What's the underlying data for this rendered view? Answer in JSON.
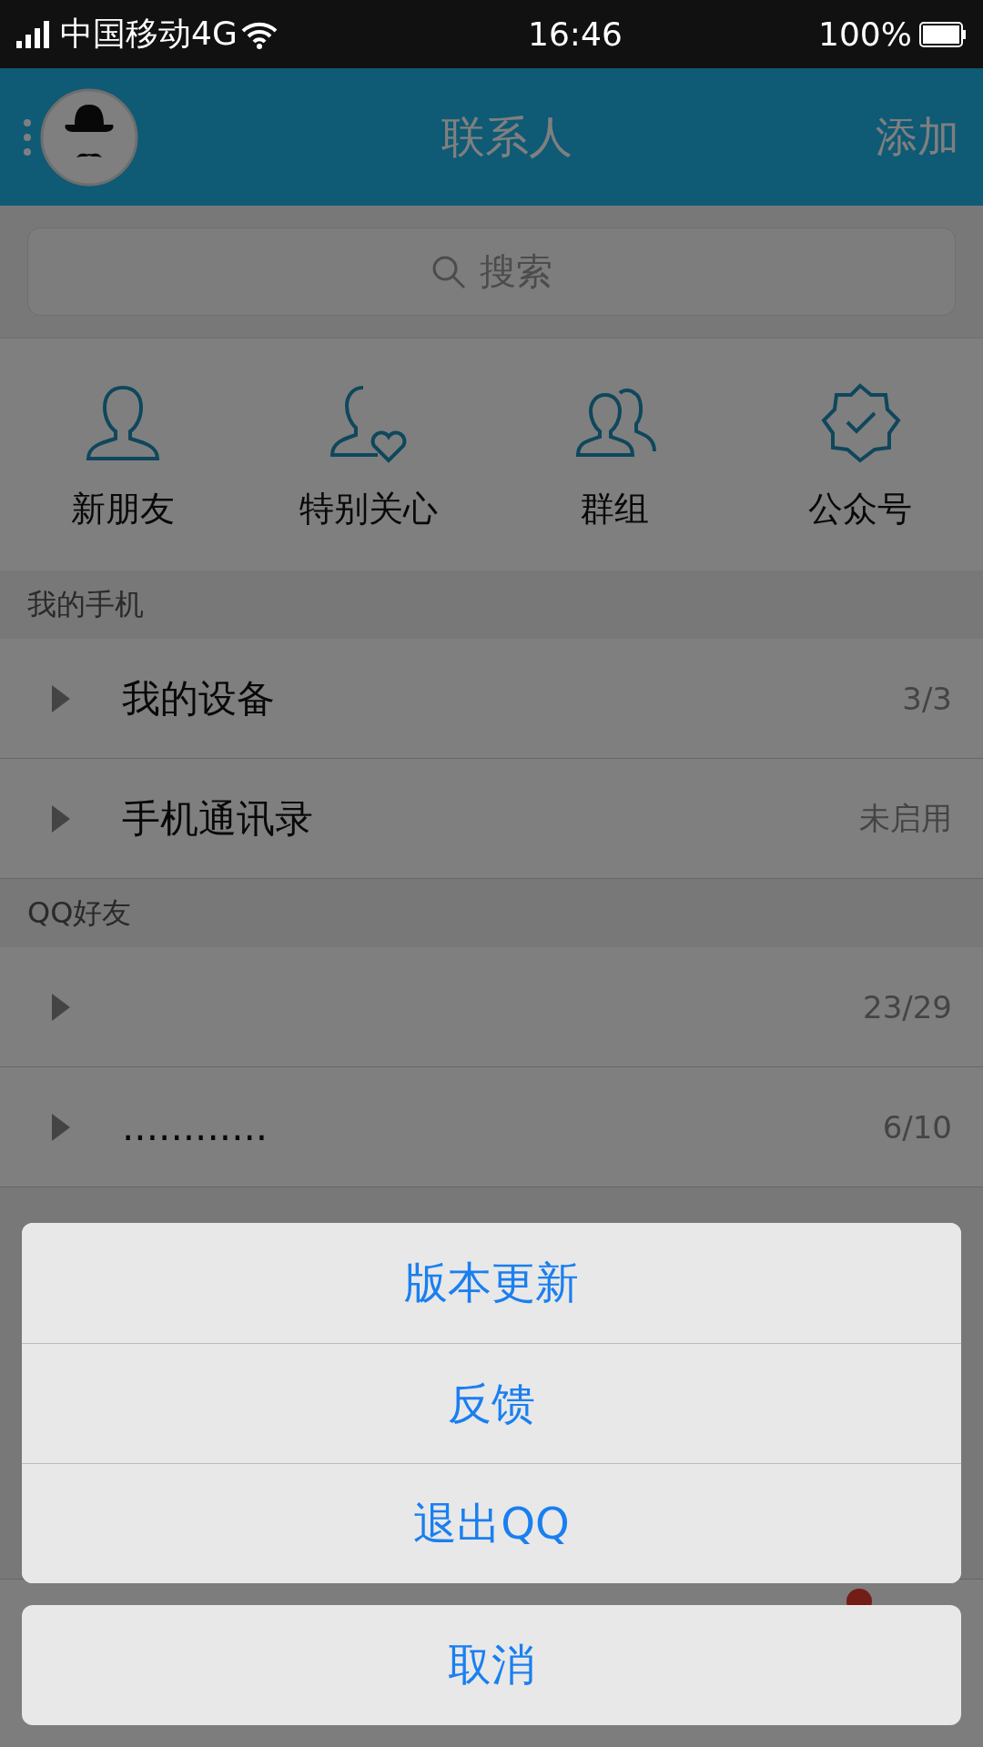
{
  "status_bar": {
    "carrier": "中国移动4G",
    "time": "16:46",
    "battery": "100%"
  },
  "header": {
    "title": "联系人",
    "action": "添加"
  },
  "search": {
    "placeholder": "搜索"
  },
  "shortcuts": [
    {
      "kind": "person",
      "label": "新朋友"
    },
    {
      "kind": "heart",
      "label": "特别关心"
    },
    {
      "kind": "group",
      "label": "群组"
    },
    {
      "kind": "badge",
      "label": "公众号"
    }
  ],
  "sections": [
    {
      "title": "我的手机",
      "groups": [
        {
          "name": "我的设备",
          "count": "3/3",
          "expanded": false
        },
        {
          "name": "手机通讯录",
          "count": "未启用",
          "expanded": false
        }
      ]
    },
    {
      "title": "QQ好友",
      "groups": [
        {
          "count": "23/29",
          "expanded": false
        },
        {
          "name": "............",
          "count": "6/10",
          "expanded": false
        }
      ]
    }
  ],
  "tab_bar": {
    "badge": true
  },
  "action_sheet": {
    "items": [
      "版本更新",
      "反馈",
      "退出QQ"
    ],
    "cancel": "取消"
  }
}
